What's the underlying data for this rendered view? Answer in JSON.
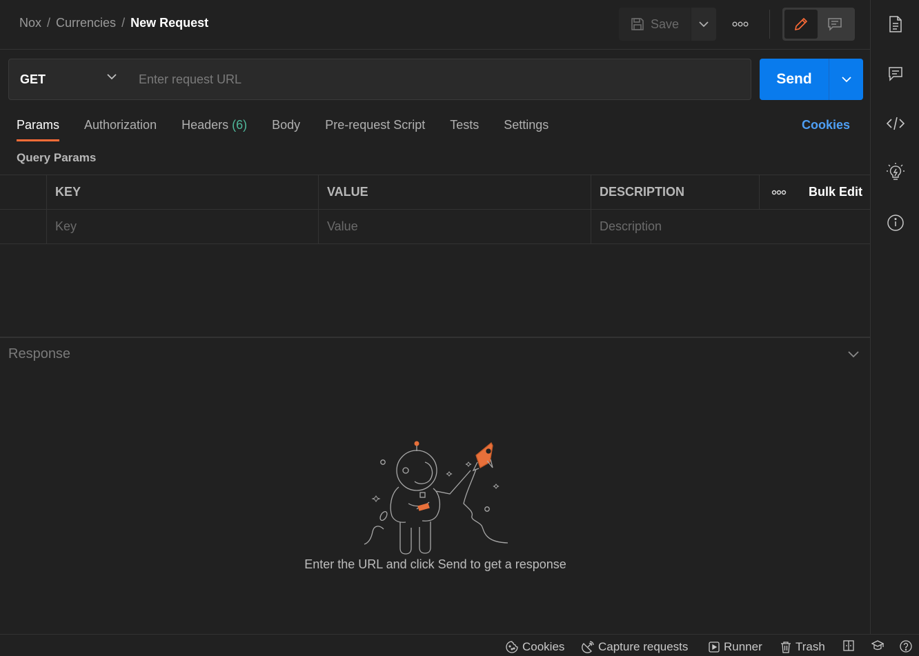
{
  "breadcrumb": {
    "workspace": "Nox",
    "collection": "Currencies",
    "request": "New Request",
    "separator": "/"
  },
  "toolbar": {
    "save_label": "Save",
    "save_icon": "save-icon",
    "more_icon": "more-horizontal-icon",
    "edit_mode_icon": "pencil-icon",
    "comment_mode_icon": "comment-icon"
  },
  "request": {
    "method": "GET",
    "url_value": "",
    "url_placeholder": "Enter request URL",
    "send_label": "Send"
  },
  "tabs": [
    {
      "label": "Params",
      "active": true
    },
    {
      "label": "Authorization"
    },
    {
      "label": "Headers",
      "count": "(6)"
    },
    {
      "label": "Body"
    },
    {
      "label": "Pre-request Script"
    },
    {
      "label": "Tests"
    },
    {
      "label": "Settings"
    }
  ],
  "cookies_link": "Cookies",
  "query_params": {
    "title": "Query Params",
    "columns": {
      "key": "KEY",
      "value": "VALUE",
      "description": "DESCRIPTION",
      "bulk_edit": "Bulk Edit"
    },
    "placeholders": {
      "key": "Key",
      "value": "Value",
      "description": "Description"
    }
  },
  "response": {
    "title": "Response",
    "empty_message": "Enter the URL and click Send to get a response"
  },
  "right_sidebar": [
    "documentation-icon",
    "comments-icon",
    "code-icon",
    "lightbulb-icon",
    "info-icon"
  ],
  "statusbar": {
    "cookies": "Cookies",
    "capture": "Capture requests",
    "runner": "Runner",
    "trash": "Trash"
  },
  "colors": {
    "accent": "#ff6c37",
    "send": "#097bed",
    "link": "#4e9ff5",
    "count": "#4fb79a",
    "background": "#212121"
  }
}
